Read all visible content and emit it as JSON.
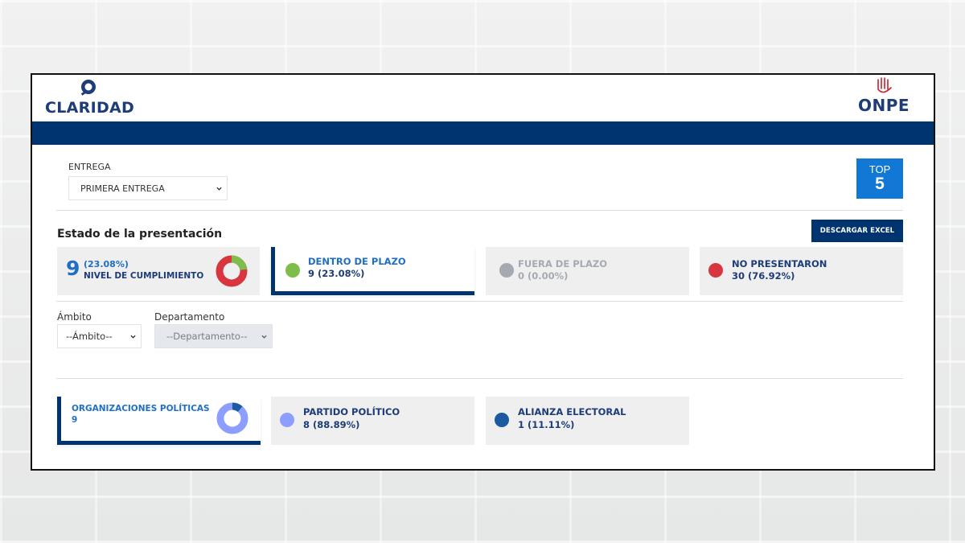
{
  "brand": {
    "left_logo": "CLARIDAD",
    "right_logo": "ONPE"
  },
  "entrega": {
    "label": "ENTREGA",
    "selected": "PRIMERA ENTREGA"
  },
  "top": {
    "line1": "TOP",
    "line2": "5"
  },
  "estado": {
    "title": "Estado de la presentación",
    "excel_button": "DESCARGAR EXCEL",
    "nivel": {
      "count": "9",
      "percent": "(23.08%)",
      "label": "NIVEL DE CUMPLIMIENTO",
      "fraction": 0.2308
    },
    "dentro": {
      "title": "DENTRO DE PLAZO",
      "value": "9 (23.08%)",
      "color": "#7ebd4a"
    },
    "fuera": {
      "title": "FUERA DE PLAZO",
      "value": "0 (0.00%)",
      "color": "#a5aab2"
    },
    "no_presentaron": {
      "title": "NO PRESENTARON",
      "value": "30 (76.92%)",
      "color": "#d9353e"
    }
  },
  "filters": {
    "ambito": {
      "label": "Ámbito",
      "selected": "--Ámbito--"
    },
    "departamento": {
      "label": "Departamento",
      "selected": "--Departamento--"
    }
  },
  "organizaciones": {
    "total": {
      "title": "ORGANIZACIONES POLÍTICAS",
      "value": "9"
    },
    "partido": {
      "title": "PARTIDO POLÍTICO",
      "value": "8 (88.89%)",
      "color": "#8c9eff",
      "fraction": 0.8889
    },
    "alianza": {
      "title": "ALIANZA ELECTORAL",
      "value": "1 (11.11%)",
      "color": "#1a5aa0",
      "fraction": 0.1111
    }
  },
  "colors": {
    "navy": "#003470",
    "accent_blue": "#1278d6"
  }
}
